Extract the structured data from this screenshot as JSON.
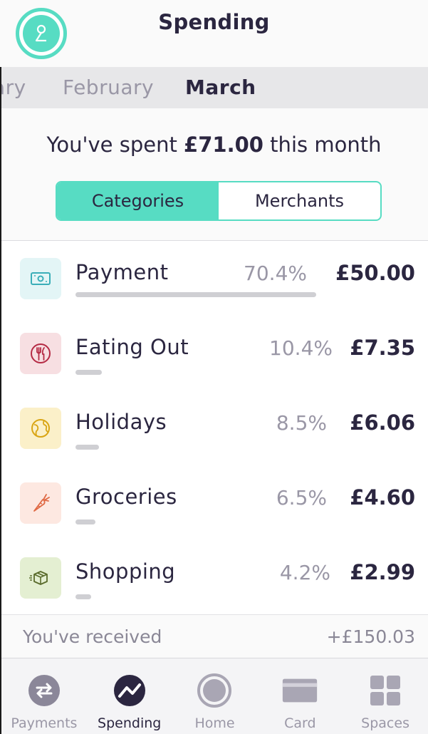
{
  "header": {
    "title": "Spending"
  },
  "months": {
    "partial": "ary",
    "previous": "February",
    "current": "March"
  },
  "summary": {
    "prefix": "You've spent ",
    "amount": "£71.00",
    "suffix": " this month"
  },
  "segmented": {
    "categories": "Categories",
    "merchants": "Merchants",
    "selected": "Categories"
  },
  "categories": [
    {
      "name": "Payment",
      "percent": "70.4%",
      "amount": "£50.00",
      "share": 0.704,
      "icon": "cash-icon",
      "tint": "#e3f5f6",
      "color": "#3aaeb8"
    },
    {
      "name": "Eating Out",
      "percent": "10.4%",
      "amount": "£7.35",
      "share": 0.104,
      "icon": "fork-knife-icon",
      "tint": "#f7dfe2",
      "color": "#b52b45"
    },
    {
      "name": "Holidays",
      "percent": "8.5%",
      "amount": "£6.06",
      "share": 0.085,
      "icon": "globe-icon",
      "tint": "#fbf0c9",
      "color": "#d9a514"
    },
    {
      "name": "Groceries",
      "percent": "6.5%",
      "amount": "£4.60",
      "share": 0.065,
      "icon": "carrot-icon",
      "tint": "#fde8e1",
      "color": "#e06a45"
    },
    {
      "name": "Shopping",
      "percent": "4.2%",
      "amount": "£2.99",
      "share": 0.042,
      "icon": "package-icon",
      "tint": "#e4efd2",
      "color": "#5a6b2c"
    }
  ],
  "received": {
    "label": "You've received",
    "amount": "+£150.03"
  },
  "tabs": [
    {
      "label": "Payments",
      "icon": "swap-arrows-icon"
    },
    {
      "label": "Spending",
      "icon": "trend-line-icon"
    },
    {
      "label": "Home",
      "icon": "home-ring-icon"
    },
    {
      "label": "Card",
      "icon": "card-icon"
    },
    {
      "label": "Spaces",
      "icon": "grid-icon"
    }
  ],
  "colors": {
    "accent": "#57dcc3",
    "text": "#2b2640",
    "muted": "#9a97a6"
  }
}
